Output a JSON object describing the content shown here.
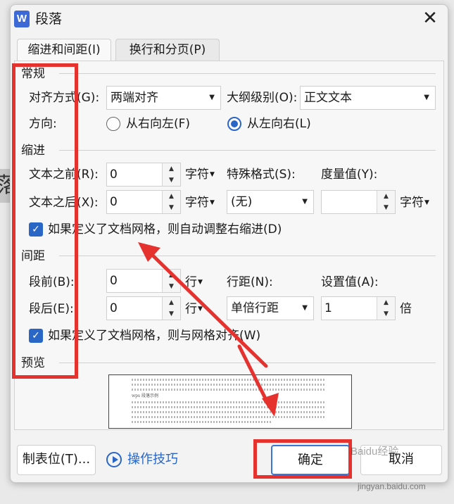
{
  "background": {
    "glyph": "落",
    "top_text": "…"
  },
  "window": {
    "title": "段落",
    "close_icon": "✕",
    "logo": "W"
  },
  "tabs": [
    {
      "label": "缩进和间距(I)",
      "active": true
    },
    {
      "label": "换行和分页(P)",
      "active": false
    }
  ],
  "general": {
    "heading": "常规",
    "align_label": "对齐方式(G):",
    "align_value": "两端对齐",
    "outline_label": "大纲级别(O):",
    "outline_value": "正文文本",
    "direction_label": "方向:",
    "rtl_label": "从右向左(F)",
    "ltr_label": "从左向右(L)",
    "direction_selected": "ltr"
  },
  "indent": {
    "heading": "缩进",
    "before_label": "文本之前(R):",
    "before_value": "0",
    "before_unit": "字符",
    "after_label": "文本之后(X):",
    "after_value": "0",
    "after_unit": "字符",
    "special_label": "特殊格式(S):",
    "special_value": "(无)",
    "measure_label": "度量值(Y):",
    "measure_value": "",
    "measure_unit": "字符",
    "grid_check_label": "如果定义了文档网格，则自动调整右缩进(D)",
    "grid_checked": true
  },
  "spacing": {
    "heading": "间距",
    "before_label": "段前(B):",
    "before_value": "0",
    "before_unit": "行",
    "after_label": "段后(E):",
    "after_value": "0",
    "after_unit": "行",
    "line_label": "行距(N):",
    "line_value": "单倍行距",
    "setting_label": "设置值(A):",
    "setting_value": "1",
    "setting_unit": "倍",
    "grid_check_label": "如果定义了文档网格，则与网格对齐(W)",
    "grid_checked": true
  },
  "preview": {
    "heading": "预览",
    "sample_text": "wps 段落示例"
  },
  "buttons": {
    "tabs": "制表位(T)...",
    "tips": "操作技巧",
    "ok": "确定",
    "cancel": "取消"
  },
  "watermark": {
    "brand": "Baidu经验",
    "url": "jingyan.baidu.com"
  },
  "colors": {
    "accent": "#2a66c6",
    "annotation": "#e5322f",
    "logo": "#3c69d6"
  }
}
